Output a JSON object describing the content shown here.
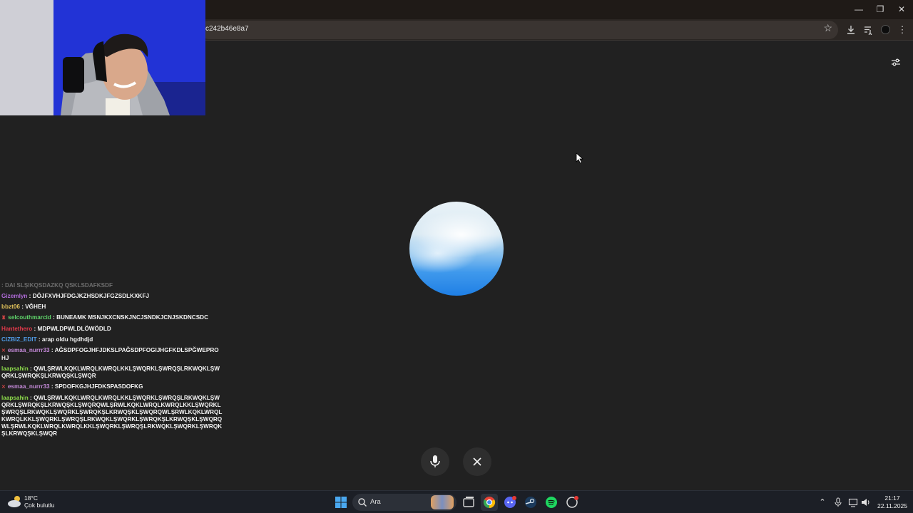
{
  "browser": {
    "url": "c242b46e8a7",
    "window_controls": {
      "minimize": "—",
      "restore": "❐",
      "close": "✕"
    },
    "toolbar_icons": [
      "download-icon",
      "media-control-icon",
      "profile-avatar",
      "more-menu-icon"
    ]
  },
  "page": {
    "colors": {
      "background": "#212121",
      "orb_top": "#e9f2f7",
      "orb_bottom": "#1f7fe5"
    },
    "buttons": [
      "microphone-icon",
      "close-icon"
    ]
  },
  "chat": {
    "messages": [
      {
        "user": "",
        "user_color": "#3b8fd9",
        "text": "DAI SLŞIKQSDAZKQ QSKLSDAFKSDF",
        "faded": true
      },
      {
        "user": "Gizemlyn",
        "user_color": "#b06bd9",
        "text": "DÖJFXVHJFDGJKZHSDKJFGZSDLKXKFJ"
      },
      {
        "user": "bbzt06",
        "user_color": "#e1c25a",
        "text": "VĞHEH"
      },
      {
        "user": "selcouthmarcid",
        "user_color": "#5fd46a",
        "text": "BUNEAMK MSNJKXCNSKJNCJSNDKJCNJSKDNCSDC",
        "badge": "♜"
      },
      {
        "user": "Hantethero",
        "user_color": "#e0394a",
        "text": "MDPWLDPWLDLÖWÖDLD"
      },
      {
        "user": "CIZBIZ_EDIT",
        "user_color": "#4f9be6",
        "text": "arap oldu hgdhdjd"
      },
      {
        "user": "esmaa_nurrr33",
        "user_color": "#c58ad9",
        "text": "AĞSDPFOGJHFJDKSLPAĞSDPFOGIJHGFKDLSPĞWEPROHJ",
        "badge": "✕"
      },
      {
        "user": "laapsahin",
        "user_color": "#8bd94a",
        "text": "QWLŞRWLKQKLWRQLKWRQLKKLŞWQRKLŞWRQŞLRKWQKLŞWQRKLŞWRQKŞLKRWQŞKLŞWQR"
      },
      {
        "user": "esmaa_nurrr33",
        "user_color": "#c58ad9",
        "text": "SPDOFKGJHJFDKSPASDOFKG",
        "badge": "✕"
      },
      {
        "user": "laapsahin",
        "user_color": "#8bd94a",
        "text": "QWLŞRWLKQKLWRQLKWRQLKKLŞWQRKLŞWRQŞLRKWQKLŞWQRKLŞWRQKŞLKRWQŞKLŞWQRQWLŞRWLKQKLWRQLKWRQLKKLŞWQRKLŞWRQŞLRKWQKLŞWQRKLŞWRQKŞLKRWQŞKLŞWQRQWLŞRWLKQKLWRQLKWRQLKKLŞWQRKLŞWRQŞLRKWQKLŞWQRKLŞWRQKŞLKRWQŞKLŞWQRQWLŞRWLKQKLWRQLKWRQLKKLŞWQRKLŞWRQŞLRKWQKLŞWQRKLŞWRQKŞLKRWQŞKLŞWQR"
      }
    ]
  },
  "taskbar": {
    "weather_temp": "18°C",
    "weather_desc": "Çok bulutlu",
    "search_placeholder": "Ara",
    "time": "21:17",
    "date": "22.11.2025",
    "apps": [
      "windows-start-icon",
      "task-view-icon",
      "chrome-icon",
      "discord-icon",
      "steam-icon",
      "spotify-icon",
      "app-icon"
    ]
  }
}
